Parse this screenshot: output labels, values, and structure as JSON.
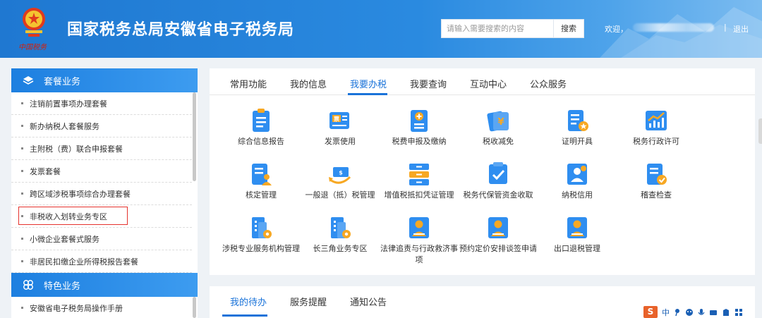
{
  "header": {
    "emblem_text": "中国税务",
    "title": "国家税务总局安徽省电子税务局",
    "search": {
      "placeholder": "请输入需要搜索的内容",
      "button": "搜索"
    },
    "welcome": "欢迎，",
    "divider": "|",
    "logout": "退出"
  },
  "sidebar": {
    "section1": {
      "title": "套餐业务",
      "icon": "layers-icon"
    },
    "items": [
      "注销前置事项办理套餐",
      "新办纳税人套餐服务",
      "主附税（费）联合申报套餐",
      "发票套餐",
      "跨区域涉税事项综合办理套餐",
      "非税收入划转业务专区",
      "小微企业套餐式服务",
      "非居民扣缴企业所得税报告套餐"
    ],
    "section2": {
      "title": "特色业务",
      "icon": "clover-icon"
    },
    "items2": [
      "安徽省电子税务局操作手册"
    ]
  },
  "main": {
    "tabs": [
      "常用功能",
      "我的信息",
      "我要办税",
      "我要查询",
      "互动中心",
      "公众服务"
    ],
    "active_tab": "我要办税",
    "grid": [
      {
        "label": "综合信息报告",
        "icon": "clipboard-icon"
      },
      {
        "label": "发票使用",
        "icon": "invoice-icon"
      },
      {
        "label": "税费申报及缴纳",
        "icon": "document-plus-icon"
      },
      {
        "label": "税收减免",
        "icon": "yuan-ticket-icon"
      },
      {
        "label": "证明开具",
        "icon": "certificate-icon"
      },
      {
        "label": "税务行政许可",
        "icon": "chart-up-icon"
      },
      {
        "label": "核定管理",
        "icon": "document-user-icon"
      },
      {
        "label": "一般退（抵）税管理",
        "icon": "refund-icon"
      },
      {
        "label": "增值税抵扣凭证管理",
        "icon": "cabinet-icon"
      },
      {
        "label": "税务代保管资金收取",
        "icon": "shield-check-icon"
      },
      {
        "label": "纳税信用",
        "icon": "user-star-icon"
      },
      {
        "label": "稽查检查",
        "icon": "document-check-icon"
      },
      {
        "label": "涉税专业服务机构管理",
        "icon": "building-gear-icon"
      },
      {
        "label": "长三角业务专区",
        "icon": "building-gear-icon"
      },
      {
        "label": "法律追责与行政救济事项",
        "icon": "person-card-icon"
      },
      {
        "label": "预约定价安排谈签申请",
        "icon": "person-card-icon"
      },
      {
        "label": "出口退税管理",
        "icon": "person-card-icon"
      }
    ]
  },
  "bottom": {
    "tabs": [
      "我的待办",
      "服务提醒",
      "通知公告"
    ],
    "active_tab": "我的待办"
  },
  "ime": {
    "logo": "S",
    "mode": "中"
  },
  "colors": {
    "primary": "#1a73d9",
    "header": "#1f78d1",
    "highlight_border": "#e5322d"
  }
}
